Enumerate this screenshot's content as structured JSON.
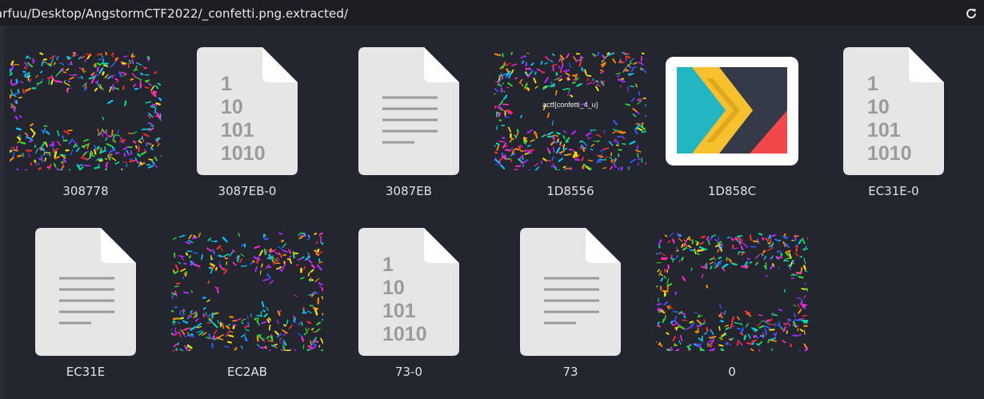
{
  "pathbar": {
    "path": "arfuu/Desktop/AngstormCTF2022/_confetti.png.extracted/",
    "refresh_icon": "refresh-icon"
  },
  "files": [
    {
      "name": "308778",
      "kind": "confetti"
    },
    {
      "name": "3087EB-0",
      "kind": "binary"
    },
    {
      "name": "3087EB",
      "kind": "text"
    },
    {
      "name": "1D8556",
      "kind": "confetti-flag",
      "overlay_text": "actf{confetti_4_u}"
    },
    {
      "name": "1D858C",
      "kind": "app-icon"
    },
    {
      "name": "EC31E-0",
      "kind": "binary"
    },
    {
      "name": "EC31E",
      "kind": "text"
    },
    {
      "name": "EC2AB",
      "kind": "confetti"
    },
    {
      "name": "73-0",
      "kind": "binary"
    },
    {
      "name": "73",
      "kind": "text"
    },
    {
      "name": "0",
      "kind": "confetti"
    }
  ],
  "binary_glyph": "1\n10\n101\n1010",
  "colors": {
    "background": "#23252f",
    "doc_page": "#e6e6e6",
    "doc_lines": "#9b9b9b",
    "app_teal": "#22b5c2",
    "app_yellow": "#f7c02c",
    "app_dark": "#353a48",
    "app_red": "#f2474b"
  }
}
